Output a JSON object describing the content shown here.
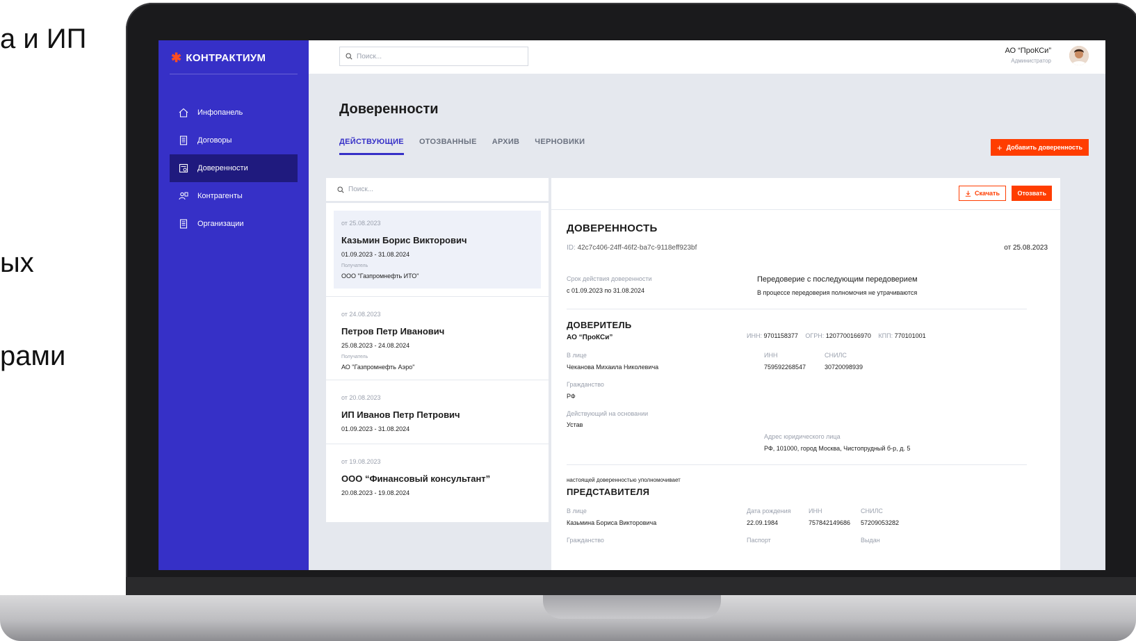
{
  "slide": {
    "line1": "а и ИП",
    "line2": "ых",
    "line3": "рами"
  },
  "sidebar": {
    "brand": "КОНТРАКТИУМ",
    "items": [
      {
        "label": "Инфопанель",
        "icon": "home-icon"
      },
      {
        "label": "Договоры",
        "icon": "document-icon"
      },
      {
        "label": "Доверенности",
        "icon": "proxy-icon",
        "active": true
      },
      {
        "label": "Контрагенты",
        "icon": "contractors-icon"
      },
      {
        "label": "Организации",
        "icon": "organization-icon"
      }
    ]
  },
  "topbar": {
    "search_placeholder": "Поиск...",
    "user_name": "АО “ПроКСи”",
    "user_role": "Администратор"
  },
  "page": {
    "title": "Доверенности",
    "tabs": [
      "ДЕЙСТВУЮЩИЕ",
      "ОТОЗВАННЫЕ",
      "АРХИВ",
      "ЧЕРНОВИКИ"
    ],
    "add_button": "Добавить доверенность"
  },
  "list": {
    "search_placeholder": "Поиск...",
    "items": [
      {
        "date": "от 25.08.2023",
        "name": "Казьмин Борис Викторович",
        "period": "01.09.2023 - 31.08.2024",
        "receiver_label": "Получатель",
        "receiver": "ООО \"Газпромнефть ИТО\""
      },
      {
        "date": "от 24.08.2023",
        "name": "Петров Петр Иванович",
        "period": "25.08.2023 - 24.08.2024",
        "receiver_label": "Получатель",
        "receiver": "АО \"Газпромнефть Аэро\""
      },
      {
        "date": "от 20.08.2023",
        "name": "ИП Иванов Петр Петрович",
        "period": "01.09.2023 - 31.08.2024"
      },
      {
        "date": "от 19.08.2023",
        "name": "ООО “Финансовый консультант”",
        "period": "20.08.2023 - 19.08.2024"
      }
    ]
  },
  "detail": {
    "download": "Скачать",
    "revoke": "Отозвать",
    "title": "ДОВЕРЕННОСТЬ",
    "id_label": "ID:",
    "id": "42c7c406-24ff-46f2-ba7c-9118eff923bf",
    "date": "от 25.08.2023",
    "term_label": "Срок действия доверенности",
    "term": "с 01.09.2023  по 31.08.2024",
    "redelegation_title": "Передоверие с последующим передоверием",
    "redelegation_note": "В процессе передоверия полномочия не утрачиваются",
    "principal": {
      "heading": "ДОВЕРИТЕЛЬ",
      "org": "АО “ПроКСи”",
      "inn_label": "ИНН:",
      "inn": "9701158377",
      "ogrn_label": "ОГРН:",
      "ogrn": "1207700166970",
      "kpp_label": "КПП:",
      "kpp": "770101001",
      "person_label": "В лице",
      "person": "Чеканова Михаила Николевича",
      "person_inn_label": "ИНН",
      "person_inn": "759592268547",
      "snils_label": "СНИЛС",
      "snils": "30720098939",
      "citizenship_label": "Гражданство",
      "citizenship": "РФ",
      "basis_label": "Действующий на основании",
      "basis": "Устав",
      "address_label": "Адрес юридического лица",
      "address": "РФ, 101000, город Москва, Чистопрудный б-р, д. 5"
    },
    "representative": {
      "intro": "настоящей доверенностью уполномочивает",
      "heading": "ПРЕДСТАВИТЕЛЯ",
      "person_label": "В лице",
      "person": "Казьмина Бориса Викторовича",
      "birth_label": "Дата рождения",
      "birth": "22.09.1984",
      "inn_label": "ИНН",
      "inn": "757842149686",
      "snils_label": "СНИЛС",
      "snils": "57209053282",
      "citizenship_label": "Гражданство",
      "passport_label": "Паспорт",
      "issued_label": "Выдан"
    }
  },
  "colors": {
    "sidebar": "#3630c7",
    "sidebar_active": "#1f1a7e",
    "accent": "#ff3d00",
    "background": "#e5e8ee"
  }
}
